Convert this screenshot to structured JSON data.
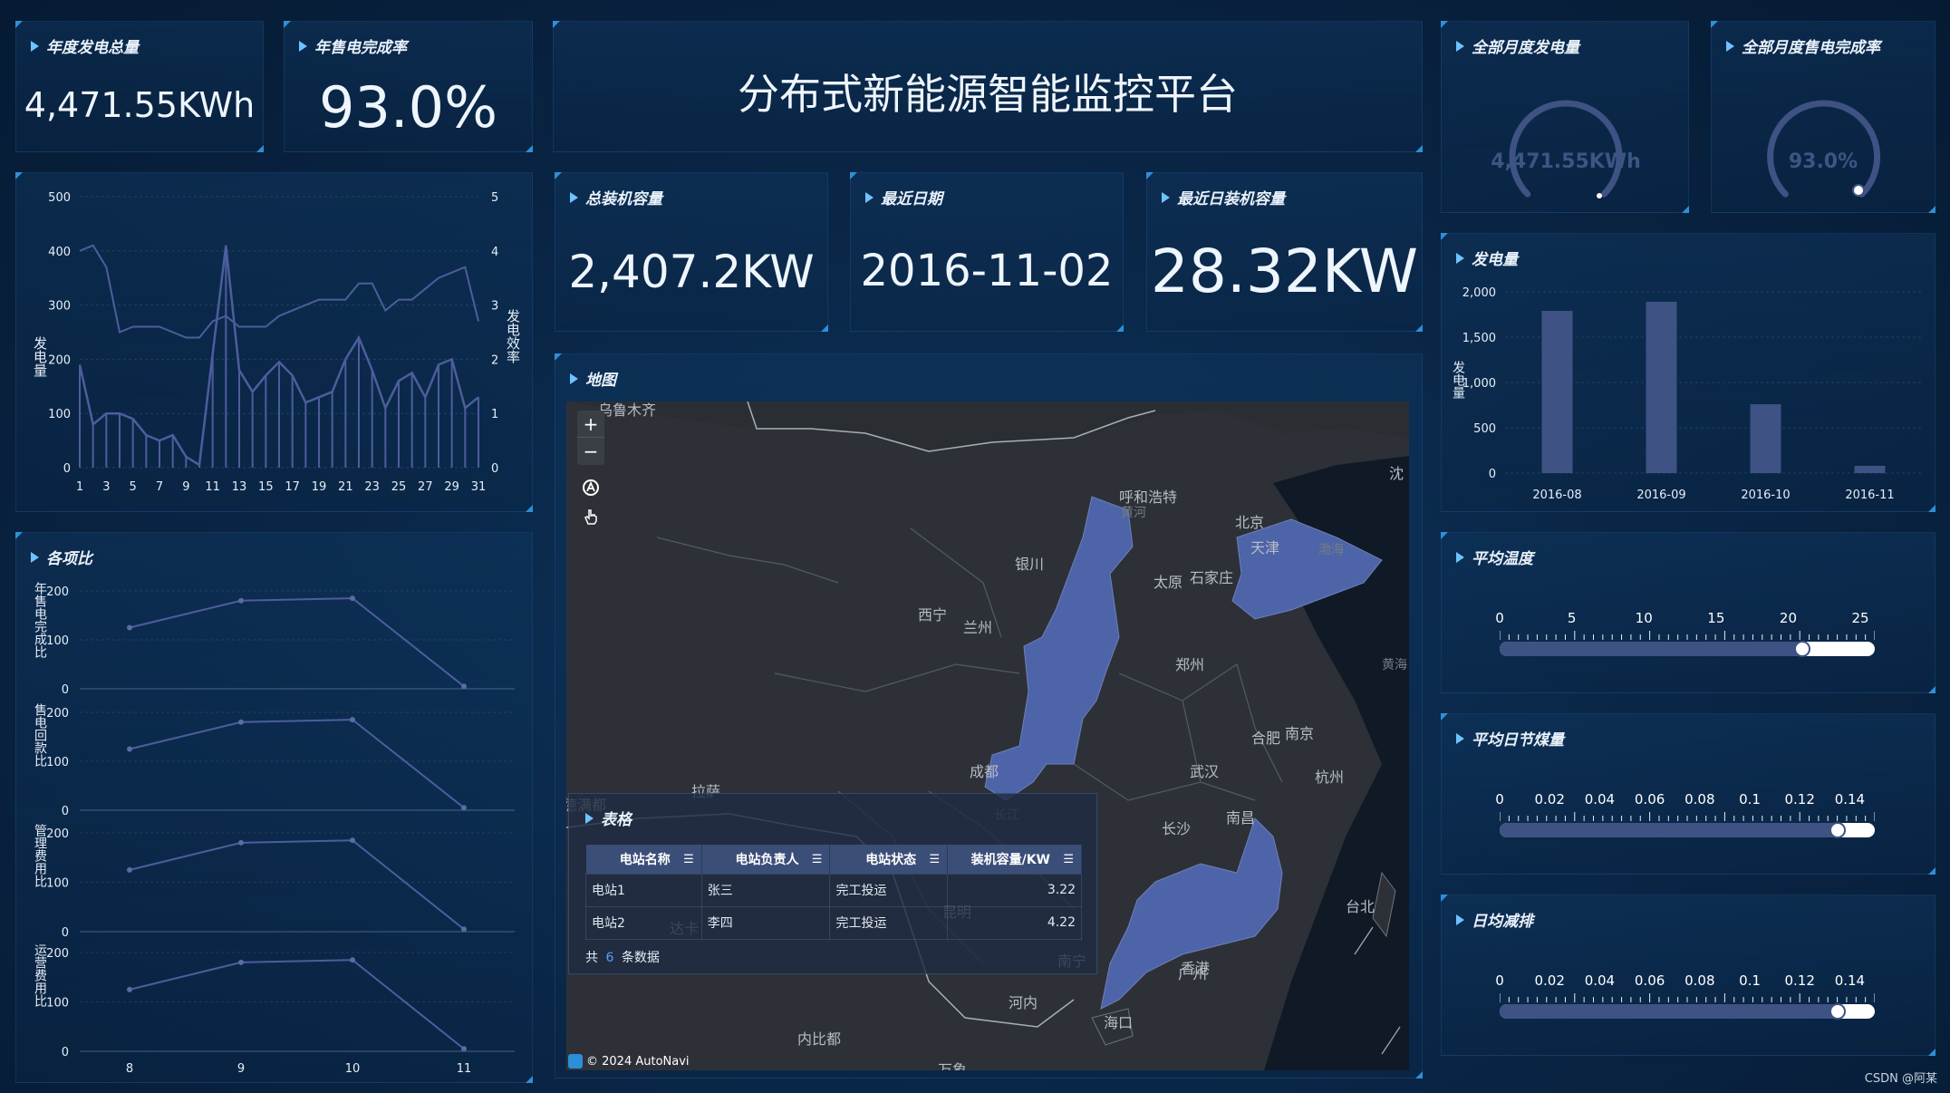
{
  "header": {
    "title": "分布式新能源智能监控平台"
  },
  "kpis": {
    "annual_generation": {
      "label": "年度发电总量",
      "value": "4,471.55KWh"
    },
    "annual_sales_rate": {
      "label": "年售电完成率",
      "value": "93.0%"
    },
    "total_capacity": {
      "label": "总装机容量",
      "value": "2,407.2KW"
    },
    "latest_date": {
      "label": "最近日期",
      "value": "2016-11-02"
    },
    "latest_capacity": {
      "label": "最近日装机容量",
      "value": "28.32KW"
    }
  },
  "gauges": {
    "monthly_generation": {
      "label": "全部月度发电量",
      "value_text": "4,471.55KWh",
      "fraction": 0.33
    },
    "monthly_sales_rate": {
      "label": "全部月度售电完成率",
      "value_text": "93.0%",
      "fraction": 0.93
    }
  },
  "daily_chart": {
    "chart_data": {
      "type": "line",
      "ylabel": "发电量",
      "ylabel2": "发电效率",
      "ylim": [
        0,
        500
      ],
      "ylim2": [
        0,
        5
      ],
      "yticks": [
        "500",
        "400",
        "300",
        "200",
        "100",
        "0"
      ],
      "yticks2": [
        "5",
        "4",
        "3",
        "2",
        "1",
        "0"
      ],
      "xticks": [
        "1",
        "3",
        "5",
        "7",
        "9",
        "11",
        "13",
        "15",
        "17",
        "19",
        "21",
        "23",
        "25",
        "27",
        "29",
        "31"
      ],
      "x": [
        1,
        2,
        3,
        4,
        5,
        6,
        7,
        8,
        9,
        10,
        11,
        12,
        13,
        14,
        15,
        16,
        17,
        18,
        19,
        20,
        21,
        22,
        23,
        24,
        25,
        26,
        27,
        28,
        29,
        30,
        31
      ],
      "series": [
        {
          "axis": "left",
          "values": [
            190,
            80,
            100,
            100,
            90,
            60,
            50,
            60,
            20,
            5,
            210,
            410,
            180,
            140,
            170,
            195,
            170,
            120,
            130,
            140,
            200,
            240,
            180,
            110,
            160,
            175,
            130,
            190,
            200,
            110,
            130,
            125
          ]
        },
        {
          "axis": "right",
          "values": [
            4.0,
            4.1,
            3.7,
            2.5,
            2.6,
            2.6,
            2.6,
            2.5,
            2.4,
            2.4,
            2.7,
            2.8,
            2.6,
            2.6,
            2.6,
            2.8,
            2.9,
            3.0,
            3.1,
            3.1,
            3.1,
            3.4,
            3.4,
            2.9,
            3.1,
            3.1,
            3.3,
            3.5,
            3.6,
            3.7,
            2.7
          ]
        }
      ]
    }
  },
  "ratios": {
    "label": "各项比",
    "chart_data": {
      "type": "line",
      "categories": [
        "8",
        "9",
        "10",
        "11"
      ],
      "yticks": [
        "200",
        "100",
        "0"
      ],
      "ylim": [
        0,
        200
      ],
      "series": [
        {
          "name": "年售电完成比",
          "values": [
            125,
            180,
            185,
            5
          ]
        },
        {
          "name": "售电回款比",
          "values": [
            125,
            180,
            185,
            5
          ]
        },
        {
          "name": "管理费用比",
          "values": [
            125,
            180,
            185,
            5
          ]
        },
        {
          "name": "运营费用比",
          "values": [
            125,
            180,
            185,
            5
          ]
        }
      ]
    }
  },
  "generation_bar": {
    "label": "发电量",
    "chart_data": {
      "type": "bar",
      "ylabel": "发电量",
      "categories": [
        "2016-08",
        "2016-09",
        "2016-10",
        "2016-11"
      ],
      "values": [
        1790,
        1890,
        760,
        80
      ],
      "ylim": [
        0,
        2000
      ],
      "yticks": [
        "2,000",
        "1,500",
        "1,000",
        "500",
        "0"
      ]
    }
  },
  "sliders": [
    {
      "label": "平均温度",
      "ticks": [
        "0",
        "5",
        "10",
        "15",
        "20",
        "25"
      ],
      "min": 0,
      "max": 26,
      "value": 21
    },
    {
      "label": "平均日节煤量",
      "ticks": [
        "0",
        "0.02",
        "0.04",
        "0.06",
        "0.08",
        "0.1",
        "0.12",
        "0.14"
      ],
      "min": 0,
      "max": 0.15,
      "value": 0.135
    },
    {
      "label": "日均减排",
      "ticks": [
        "0",
        "0.02",
        "0.04",
        "0.06",
        "0.08",
        "0.1",
        "0.12",
        "0.14"
      ],
      "min": 0,
      "max": 0.15,
      "value": 0.135
    }
  ],
  "map": {
    "label": "地图",
    "zoom_in": "+",
    "zoom_out": "−",
    "attribution": "© 2024 AutoNavi",
    "cities": [
      "乌鲁木齐",
      "呼和浩特",
      "黄河",
      "北京",
      "天津",
      "渤海",
      "银川",
      "太原",
      "石家庄",
      "西宁",
      "兰州",
      "郑州",
      "黄海",
      "合肥",
      "南京",
      "成都",
      "武汉",
      "杭州",
      "拉萨",
      "长江",
      "长沙",
      "南昌",
      "台北",
      "昆明",
      "达卡",
      "南宁",
      "广州",
      "香港",
      "河内",
      "海口",
      "内比都",
      "万象",
      "沈",
      "德满都"
    ]
  },
  "table": {
    "label": "表格",
    "columns": [
      "电站名称",
      "电站负责人",
      "电站状态",
      "装机容量/KW"
    ],
    "rows": [
      [
        "电站1",
        "张三",
        "完工投运",
        "3.22"
      ],
      [
        "电站2",
        "李四",
        "完工投运",
        "4.22"
      ]
    ],
    "footer_prefix": "共",
    "footer_count": "6",
    "footer_suffix": "条数据"
  },
  "watermark": "CSDN @阿某",
  "colors": {
    "accent": "#2f8fd8",
    "series": "#4d5d9c",
    "province": "#4e64a8",
    "bar": "#3e5283"
  }
}
